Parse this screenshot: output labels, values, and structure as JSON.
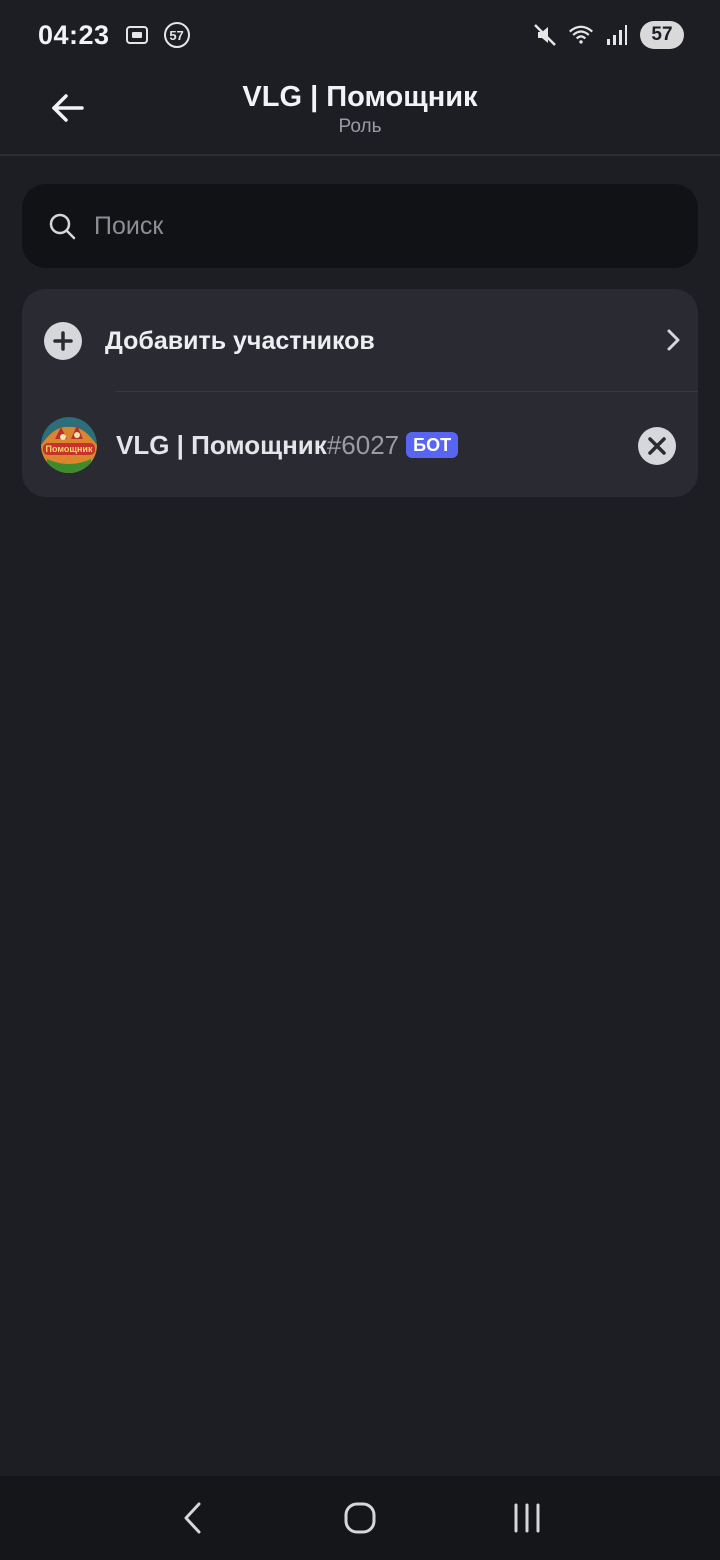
{
  "status_bar": {
    "time": "04:23",
    "notification_count": "57",
    "battery": "57",
    "icons": [
      "screenshot-icon",
      "mute-icon",
      "wifi-icon",
      "signal-icon"
    ]
  },
  "header": {
    "title": "VLG | Помощник",
    "subtitle": "Роль",
    "back_icon": "arrow-left-icon"
  },
  "search": {
    "placeholder": "Поиск",
    "value": ""
  },
  "members_card": {
    "add_label": "Добавить участников",
    "members": [
      {
        "name": "VLG | Помощник",
        "discriminator": "#6027",
        "badge": "БОТ",
        "avatar_text": "Помощник"
      }
    ]
  },
  "nav": {
    "buttons": [
      "back-nav-icon",
      "home-nav-icon",
      "recents-nav-icon"
    ]
  },
  "colors": {
    "background": "#1d1e24",
    "card": "#2a2b32",
    "search_bg": "#111216",
    "badge": "#5865f2"
  }
}
